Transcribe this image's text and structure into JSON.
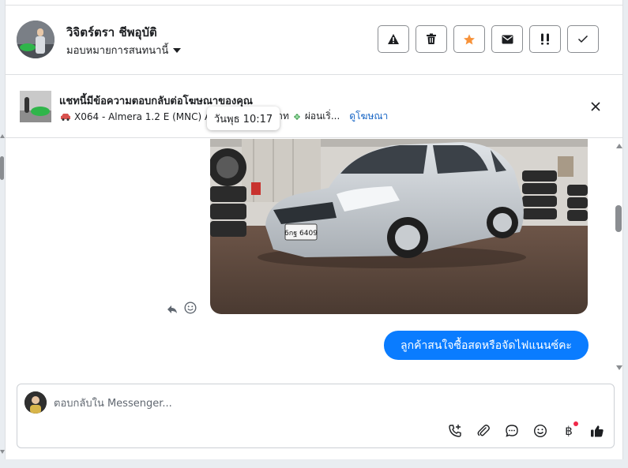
{
  "header": {
    "contact_name": "วิจิตร์ตรา ชีพอุบัติ",
    "assign_label": "มอบหมายการสนทนานี้",
    "action_icons": [
      "alert-icon",
      "trash-icon",
      "star-icon",
      "mail-icon",
      "double-exclamation-icon",
      "check-icon"
    ]
  },
  "ad": {
    "title": "แชทนี้มีข้อความตอบกลับต่อโฆษณาของคุณ",
    "subtitle_part1": "X064 - Almera 1.2 E (MNC) AT",
    "subtitle_part2": "บาท",
    "subtitle_part3": "ผ่อนเริ่...",
    "link_label": "ดูโฆษณา"
  },
  "tooltip": {
    "time": "วันพุธ 10:17"
  },
  "chat": {
    "car_plate": "6กฐ 6409",
    "outgoing_message": "ลูกค้าสนใจซื้อสดหรือจัดไฟแนนซ์คะ"
  },
  "composer": {
    "placeholder": "ตอบกลับใน Messenger...",
    "baht_symbol": "฿"
  },
  "colors": {
    "accent_blue": "#0a7cff",
    "star_orange": "#f7923a",
    "link_blue": "#1463c4",
    "notification_red": "#f02849"
  }
}
